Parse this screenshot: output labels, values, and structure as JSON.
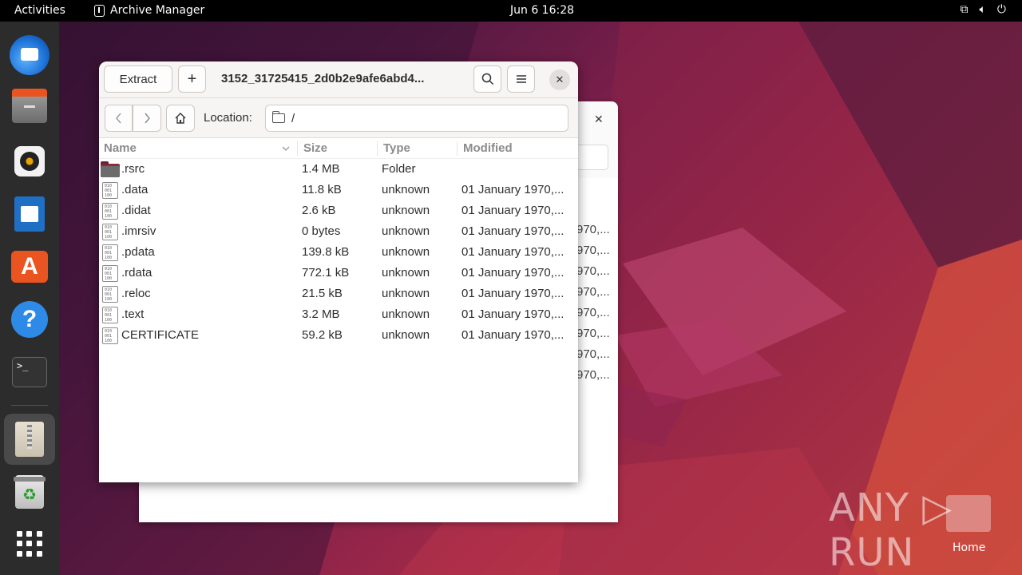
{
  "topbar": {
    "activities": "Activities",
    "app_name": "Archive Manager",
    "clock": "Jun 6  16:28",
    "tray_icons": [
      "network-icon",
      "volume-icon",
      "power-icon"
    ]
  },
  "dock": {
    "items": [
      {
        "name": "thunderbird",
        "icon": "thunderbird-icon"
      },
      {
        "name": "files",
        "icon": "files-icon"
      },
      {
        "name": "rhythmbox",
        "icon": "rhythmbox-icon"
      },
      {
        "name": "writer",
        "icon": "writer-icon"
      },
      {
        "name": "app-center",
        "icon": "app-center-icon"
      },
      {
        "name": "help",
        "icon": "help-icon"
      },
      {
        "name": "terminal",
        "icon": "terminal-icon"
      },
      {
        "name": "archive-manager",
        "icon": "archive-icon",
        "active": true
      },
      {
        "name": "trash",
        "icon": "trash-icon"
      },
      {
        "name": "show-apps",
        "icon": "grid-icon"
      }
    ],
    "terminal_glyph": ">_",
    "appcenter_glyph": "A",
    "help_glyph": "?",
    "trash_glyph": "♻"
  },
  "window": {
    "extract_label": "Extract",
    "add_label": "+",
    "title": "3152_31725415_2d0b2e9afe6abd4...",
    "close_glyph": "✕",
    "location_label": "Location:",
    "location_value": "/",
    "columns": {
      "name": "Name",
      "size": "Size",
      "type": "Type",
      "modified": "Modified"
    },
    "files": [
      {
        "name": ".rsrc",
        "size": "1.4 MB",
        "type": "Folder",
        "modified": "",
        "kind": "folder"
      },
      {
        "name": ".data",
        "size": "11.8 kB",
        "type": "unknown",
        "modified": "01 January 1970,...",
        "kind": "file"
      },
      {
        "name": ".didat",
        "size": "2.6 kB",
        "type": "unknown",
        "modified": "01 January 1970,...",
        "kind": "file"
      },
      {
        "name": ".imrsiv",
        "size": "0 bytes",
        "type": "unknown",
        "modified": "01 January 1970,...",
        "kind": "file"
      },
      {
        "name": ".pdata",
        "size": "139.8 kB",
        "type": "unknown",
        "modified": "01 January 1970,...",
        "kind": "file"
      },
      {
        "name": ".rdata",
        "size": "772.1 kB",
        "type": "unknown",
        "modified": "01 January 1970,...",
        "kind": "file"
      },
      {
        "name": ".reloc",
        "size": "21.5 kB",
        "type": "unknown",
        "modified": "01 January 1970,...",
        "kind": "file"
      },
      {
        "name": ".text",
        "size": "3.2 MB",
        "type": "unknown",
        "modified": "01 January 1970,...",
        "kind": "file"
      },
      {
        "name": "CERTIFICATE",
        "size": "59.2 kB",
        "type": "unknown",
        "modified": "01 January 1970,...",
        "kind": "file"
      }
    ]
  },
  "background_window": {
    "close_glyph": "✕",
    "modified_values": [
      "970,...",
      "970,...",
      "970,...",
      "970,...",
      "970,...",
      "970,...",
      "970,...",
      "970,..."
    ]
  },
  "desktop": {
    "watermark": "ANY ▷ RUN",
    "home_label": "Home"
  },
  "colors": {
    "accent": "#e95420",
    "folder": "#6c6c6c",
    "topbar": "#000000",
    "dock": "#2c2c2c"
  }
}
